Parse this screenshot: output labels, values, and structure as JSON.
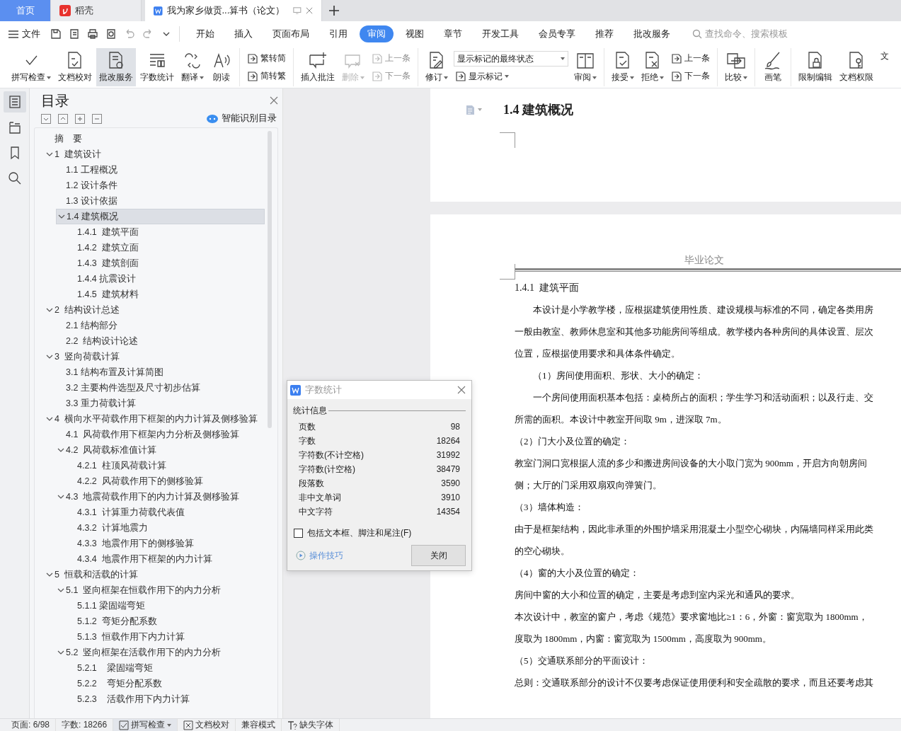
{
  "window_tabs": [
    {
      "kind": "home",
      "label": "首页",
      "selected": false
    },
    {
      "kind": "app",
      "label": "稻壳",
      "selected": false
    },
    {
      "kind": "doc",
      "label": "我为家乡做贡...算书（论文）",
      "selected": true
    }
  ],
  "menu": {
    "file": "文件",
    "tabs": [
      {
        "label": "开始",
        "selected": false
      },
      {
        "label": "插入",
        "selected": false
      },
      {
        "label": "页面布局",
        "selected": false
      },
      {
        "label": "引用",
        "selected": false
      },
      {
        "label": "审阅",
        "selected": true
      },
      {
        "label": "视图",
        "selected": false
      },
      {
        "label": "章节",
        "selected": false
      },
      {
        "label": "开发工具",
        "selected": false
      },
      {
        "label": "会员专享",
        "selected": false
      },
      {
        "label": "推荐",
        "selected": false
      },
      {
        "label": "批改服务",
        "selected": false
      }
    ],
    "search": {
      "placeholder": "查找命令、搜索模板"
    }
  },
  "ribbon": [
    {
      "items": [
        {
          "kind": "big",
          "label": "拼写检查",
          "caret": true,
          "disabled": false,
          "pressed": false
        },
        {
          "kind": "big",
          "label": "文档校对",
          "caret": false,
          "disabled": false,
          "pressed": false
        },
        {
          "kind": "big",
          "label": "批改服务",
          "caret": false,
          "disabled": false,
          "pressed": true
        },
        {
          "kind": "big",
          "label": "字数统计",
          "caret": false,
          "disabled": false,
          "pressed": false
        },
        {
          "kind": "big",
          "label": "翻译",
          "caret": true,
          "disabled": false,
          "pressed": false
        },
        {
          "kind": "big",
          "label": "朗读",
          "caret": false,
          "disabled": false,
          "pressed": false
        }
      ]
    },
    {
      "items": [
        {
          "kind": "stack",
          "buttons": [
            {
              "kind": "button",
              "label": "繁转简",
              "caret": false,
              "disabled": false
            },
            {
              "kind": "button",
              "label": "简转繁",
              "caret": false,
              "disabled": false
            }
          ]
        }
      ]
    },
    {
      "items": [
        {
          "kind": "big",
          "label": "插入批注",
          "caret": false,
          "disabled": false,
          "pressed": false
        },
        {
          "kind": "big",
          "label": "删除",
          "caret": true,
          "disabled": true,
          "pressed": false
        },
        {
          "kind": "stack",
          "buttons": [
            {
              "kind": "button",
              "label": "上一条",
              "caret": false,
              "disabled": true
            },
            {
              "kind": "button",
              "label": "下一条",
              "caret": false,
              "disabled": true
            }
          ]
        }
      ]
    },
    {
      "items": [
        {
          "kind": "big",
          "label": "修订",
          "caret": true,
          "disabled": false,
          "pressed": false
        },
        {
          "kind": "stack",
          "buttons": [
            {
              "kind": "dropdown",
              "label": "显示标记的最终状态",
              "caret": true,
              "disabled": false
            },
            {
              "kind": "button",
              "label": "显示标记",
              "caret": true,
              "disabled": false
            }
          ]
        },
        {
          "kind": "big",
          "label": "审阅",
          "caret": true,
          "disabled": false,
          "pressed": false
        }
      ]
    },
    {
      "items": [
        {
          "kind": "big",
          "label": "接受",
          "caret": true,
          "disabled": false,
          "pressed": false
        },
        {
          "kind": "big",
          "label": "拒绝",
          "caret": true,
          "disabled": false,
          "pressed": false
        },
        {
          "kind": "stack",
          "buttons": [
            {
              "kind": "button",
              "label": "上一条",
              "caret": false,
              "disabled": false
            },
            {
              "kind": "button",
              "label": "下一条",
              "caret": false,
              "disabled": false
            }
          ]
        }
      ]
    },
    {
      "items": [
        {
          "kind": "big",
          "label": "比较",
          "caret": true,
          "disabled": false,
          "pressed": false
        }
      ]
    },
    {
      "items": [
        {
          "kind": "big",
          "label": "画笔",
          "caret": false,
          "disabled": false,
          "pressed": false
        }
      ]
    },
    {
      "items": [
        {
          "kind": "big",
          "label": "限制编辑",
          "caret": false,
          "disabled": false,
          "pressed": false
        },
        {
          "kind": "big",
          "label": "文档权限",
          "caret": false,
          "disabled": false,
          "pressed": false
        },
        {
          "kind": "big",
          "label": "文",
          "caret": false,
          "disabled": false,
          "pressed": false
        }
      ]
    }
  ],
  "nav_rail": [
    {
      "selected": true
    },
    {
      "selected": false
    },
    {
      "selected": false
    },
    {
      "selected": false
    }
  ],
  "toc": {
    "title": "目录",
    "smart_button": "智能识别目录",
    "items": [
      {
        "label": "摘　要",
        "selected": false
      },
      {
        "label": "1  建筑设计",
        "selected": false,
        "expanded": true,
        "children": [
          {
            "label": "1.1 工程概况",
            "selected": false
          },
          {
            "label": "1.2 设计条件",
            "selected": false
          },
          {
            "label": "1.3 设计依据",
            "selected": false
          },
          {
            "label": "1.4 建筑概况",
            "selected": true,
            "expanded": true,
            "children": [
              {
                "label": "1.4.1  建筑平面",
                "selected": false
              },
              {
                "label": "1.4.2  建筑立面",
                "selected": false
              },
              {
                "label": "1.4.3  建筑剖面",
                "selected": false
              },
              {
                "label": "1.4.4 抗震设计",
                "selected": false
              },
              {
                "label": "1.4.5  建筑材料",
                "selected": false
              }
            ]
          }
        ]
      },
      {
        "label": "2  结构设计总述",
        "selected": false,
        "expanded": true,
        "children": [
          {
            "label": "2.1 结构部分",
            "selected": false
          },
          {
            "label": "2.2  结构设计论述",
            "selected": false
          }
        ]
      },
      {
        "label": "3  竖向荷载计算",
        "selected": false,
        "expanded": true,
        "children": [
          {
            "label": "3.1 结构布置及计算简图",
            "selected": false
          },
          {
            "label": "3.2 主要构件选型及尺寸初步估算",
            "selected": false
          },
          {
            "label": "3.3 重力荷载计算",
            "selected": false
          }
        ]
      },
      {
        "label": "4  横向水平荷载作用下框架的内力计算及侧移验算",
        "selected": false,
        "expanded": true,
        "children": [
          {
            "label": "4.1  风荷载作用下框架内力分析及侧移验算",
            "selected": false
          },
          {
            "label": "4.2  风荷载标准值计算",
            "selected": false,
            "expanded": true,
            "children": [
              {
                "label": "4.2.1  柱顶风荷载计算",
                "selected": false
              },
              {
                "label": "4.2.2  风荷载作用下的侧移验算",
                "selected": false
              }
            ]
          },
          {
            "label": "4.3  地震荷载作用下的内力计算及侧移验算",
            "selected": false,
            "expanded": true,
            "children": [
              {
                "label": "4.3.1  计算重力荷载代表值",
                "selected": false
              },
              {
                "label": "4.3.2  计算地震力",
                "selected": false
              },
              {
                "label": "4.3.3  地震作用下的侧移验算",
                "selected": false
              },
              {
                "label": "4.3.4  地震作用下框架的内力计算",
                "selected": false
              }
            ]
          }
        ]
      },
      {
        "label": "5  恒载和活载的计算",
        "selected": false,
        "expanded": true,
        "children": [
          {
            "label": "5.1  竖向框架在恒载作用下的内力分析",
            "selected": false,
            "expanded": true,
            "children": [
              {
                "label": "5.1.1 梁固端弯矩",
                "selected": false
              },
              {
                "label": "5.1.2  弯矩分配系数",
                "selected": false
              },
              {
                "label": "5.1.3  恒载作用下内力计算",
                "selected": false
              }
            ]
          },
          {
            "label": "5.2  竖向框架在活载作用下的内力分析",
            "selected": false,
            "expanded": true,
            "children": [
              {
                "label": "5.2.1    梁固端弯矩",
                "selected": false
              },
              {
                "label": "5.2.2    弯矩分配系数",
                "selected": false
              },
              {
                "label": "5.2.3    活载作用下内力计算",
                "selected": false
              }
            ]
          }
        ]
      }
    ]
  },
  "document": {
    "pages": [
      {
        "blocks": [
          {
            "kind": "heading",
            "text": "1.4 建筑概况"
          }
        ]
      },
      {
        "header": "毕业论文",
        "blocks": [
          {
            "kind": "subheading",
            "text": "1.4.1  建筑平面",
            "indent": false
          },
          {
            "kind": "line",
            "text": "本设计是小学教学楼，应根据建筑使用性质、建设规模与标准的不同，确定各类用房",
            "indent": true
          },
          {
            "kind": "line",
            "text": "一般由教室、教师休息室和其他多功能房间等组成。教学楼内各种房间的具体设置、层次",
            "indent": false
          },
          {
            "kind": "line",
            "text": "位置，应根据使用要求和具体条件确定。",
            "indent": false
          },
          {
            "kind": "line",
            "text": "（1）房间使用面积、形状、大小的确定：",
            "indent": true
          },
          {
            "kind": "line",
            "text": "一个房间使用面积基本包括：桌椅所占的面积；学生学习和活动面积；以及行走、交",
            "indent": true
          },
          {
            "kind": "line",
            "text": "所需的面积。本设计中教室开间取 9m，进深取 7m。",
            "indent": false
          },
          {
            "kind": "line",
            "text": "（2）门大小及位置的确定：",
            "indent": false
          },
          {
            "kind": "line",
            "text": "教室门洞口宽根据人流的多少和搬进房间设备的大小取门宽为 900mm，开启方向朝房间",
            "indent": false
          },
          {
            "kind": "line",
            "text": "侧；大厅的门采用双扇双向弹簧门。",
            "indent": false
          },
          {
            "kind": "line",
            "text": "（3）墙体构造：",
            "indent": false
          },
          {
            "kind": "line",
            "text": "由于是框架结构，因此非承重的外围护墙采用混凝土小型空心砌块，内隔墙同样采用此类",
            "indent": false
          },
          {
            "kind": "line",
            "text": "的空心砌块。",
            "indent": false
          },
          {
            "kind": "line",
            "text": "（4）窗的大小及位置的确定：",
            "indent": false
          },
          {
            "kind": "line",
            "text": "房间中窗的大小和位置的确定，主要是考虑到室内采光和通风的要求。",
            "indent": false
          },
          {
            "kind": "line",
            "text": "本次设计中，教室的窗户，考虑《规范》要求窗地比≥1：6，外窗：窗宽取为 1800mm，",
            "indent": false
          },
          {
            "kind": "line",
            "text": "度取为 1800mm，内窗：窗宽取为 1500mm，高度取为 900mm。",
            "indent": false
          },
          {
            "kind": "line",
            "text": "（5）交通联系部分的平面设计：",
            "indent": false
          },
          {
            "kind": "line",
            "text": "总则：交通联系部分的设计不仅要考虑保证使用便利和安全疏散的要求，而且还要考虑其",
            "indent": false
          }
        ]
      }
    ]
  },
  "dialog": {
    "title": "字数统计",
    "group": "统计信息",
    "rows": [
      {
        "label": "页数",
        "value": "98"
      },
      {
        "label": "字数",
        "value": "18264"
      },
      {
        "label": "字符数(不计空格)",
        "value": "31992"
      },
      {
        "label": "字符数(计空格)",
        "value": "38479"
      },
      {
        "label": "段落数",
        "value": "3590"
      },
      {
        "label": "非中文单词",
        "value": "3910"
      },
      {
        "label": "中文字符",
        "value": "14354"
      }
    ],
    "checkbox": {
      "label": "包括文本框、脚注和尾注(F)",
      "checked": false
    },
    "tips": "操作技巧",
    "close": "关闭"
  },
  "status_bar": [
    {
      "kind": "text",
      "label": "页面: 6/98",
      "on": false,
      "caret": false
    },
    {
      "kind": "text",
      "label": "字数: 18266",
      "on": false,
      "caret": false
    },
    {
      "kind": "toggle",
      "label": "拼写检查",
      "on": true,
      "caret": true
    },
    {
      "kind": "toggle",
      "label": "文档校对",
      "on": false,
      "caret": false
    },
    {
      "kind": "text",
      "label": "兼容模式",
      "on": false,
      "caret": false
    },
    {
      "kind": "font",
      "label": "缺失字体",
      "on": false,
      "caret": false
    }
  ]
}
